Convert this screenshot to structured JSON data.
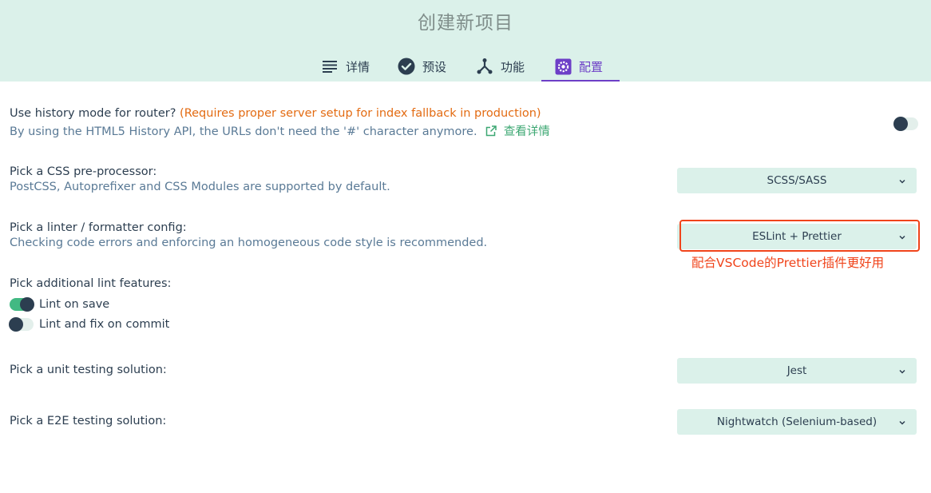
{
  "window": {
    "title": "创建新项目"
  },
  "tabs": [
    {
      "label": "详情",
      "icon": "list-icon",
      "active": false
    },
    {
      "label": "预设",
      "icon": "check-circle-icon",
      "active": false
    },
    {
      "label": "功能",
      "icon": "fork-icon",
      "active": false
    },
    {
      "label": "配置",
      "icon": "settings-icon",
      "active": true
    }
  ],
  "colors": {
    "accent": "#6d3fc7",
    "green": "#42b983",
    "header_bg": "#dbf1ea",
    "annotation": "#f0441b",
    "warning": "#e36b12"
  },
  "history_mode": {
    "label": "Use history mode for router?",
    "warning": "(Requires proper server setup for index fallback in production)",
    "description": "By using the HTML5 History API, the URLs don't need the '#' character anymore.",
    "link_label": "查看详情",
    "enabled": false
  },
  "css_preprocessor": {
    "label": "Pick a CSS pre-processor:",
    "description": "PostCSS, Autoprefixer and CSS Modules are supported by default.",
    "value": "SCSS/SASS"
  },
  "linter": {
    "label": "Pick a linter / formatter config:",
    "description": "Checking code errors and enforcing an homogeneous code style is recommended.",
    "value": "ESLint + Prettier",
    "annotation": "配合VSCode的Prettier插件更好用"
  },
  "lint_features": {
    "label": "Pick additional lint features:",
    "items": [
      {
        "label": "Lint on save",
        "enabled": true
      },
      {
        "label": "Lint and fix on commit",
        "enabled": false
      }
    ]
  },
  "unit_testing": {
    "label": "Pick a unit testing solution:",
    "value": "Jest"
  },
  "e2e_testing": {
    "label": "Pick a E2E testing solution:",
    "value": "Nightwatch (Selenium-based)"
  }
}
